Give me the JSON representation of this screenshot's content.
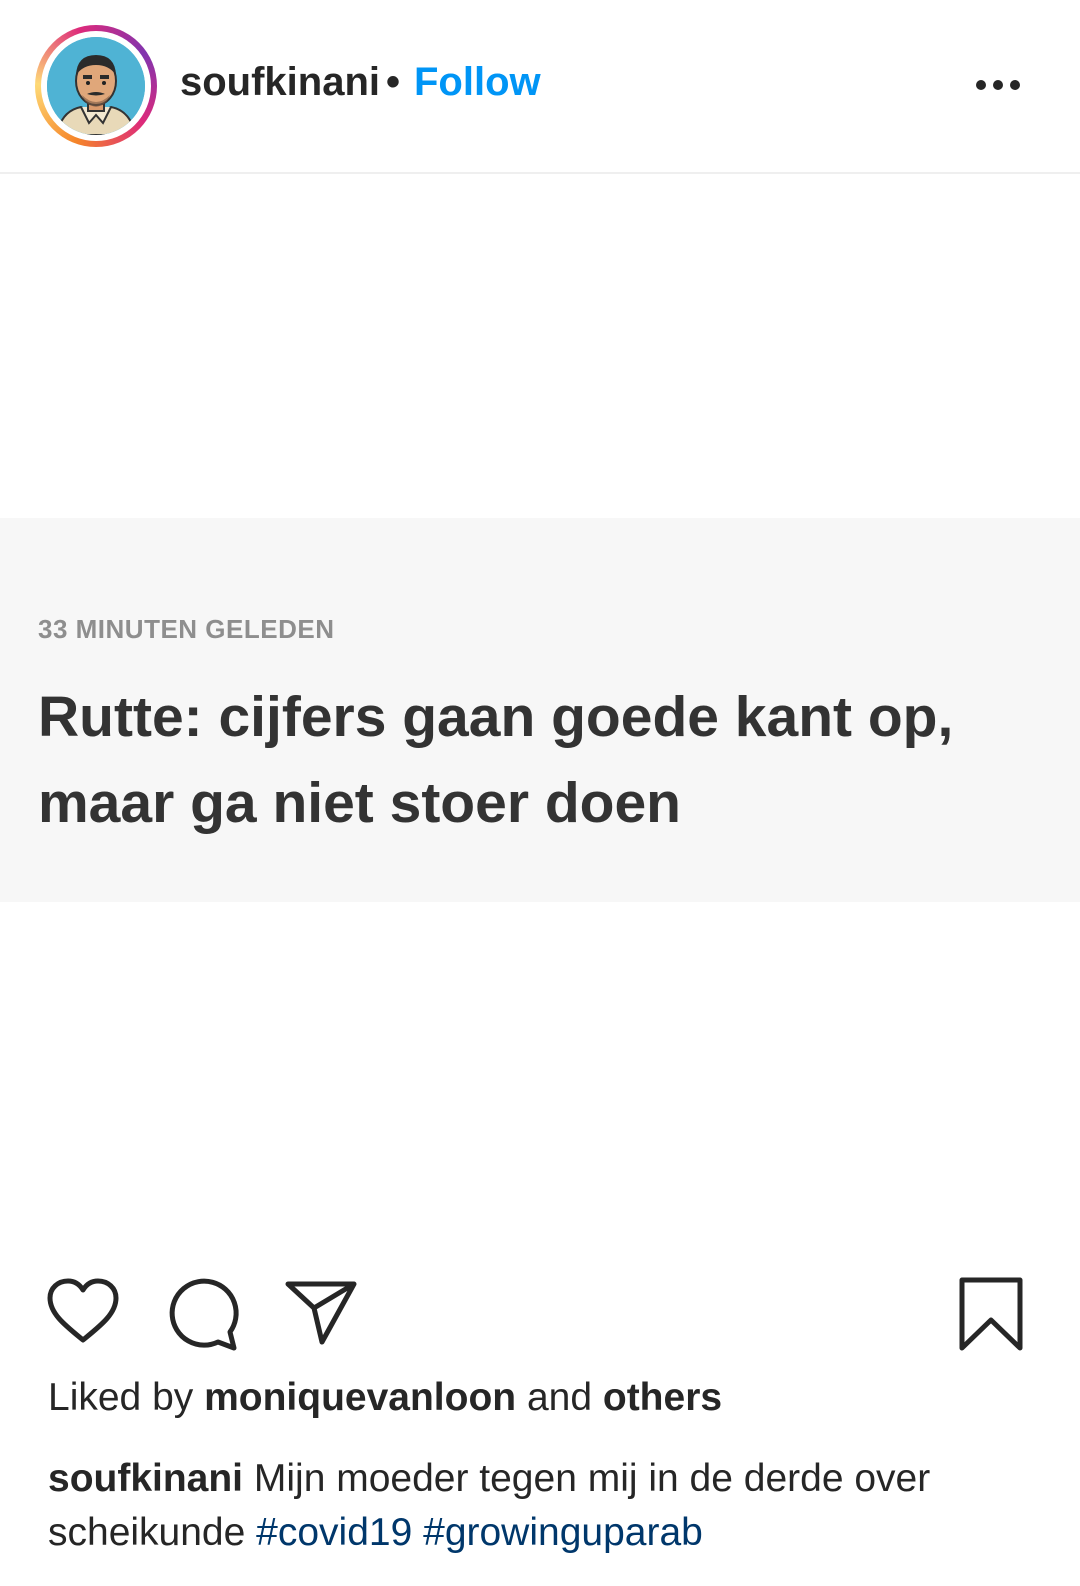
{
  "post": {
    "author": "soufkinani",
    "separator": "•",
    "follow_label": "Follow",
    "news": {
      "time": "33 MINUTEN GELEDEN",
      "headline": "Rutte: cijfers gaan goede kant op, maar ga niet stoer doen"
    },
    "likes": {
      "prefix": "Liked by",
      "user": "moniquevanloon",
      "middle": "and",
      "suffix": "others"
    },
    "caption": {
      "author": "soufkinani",
      "text": "Mijn moeder tegen mij in de derde over scheikunde",
      "hashtags": [
        "#covid19",
        "#growinguparab"
      ]
    }
  },
  "icons": {
    "more": "more-options-icon",
    "like": "heart-icon",
    "comment": "comment-icon",
    "share": "send-icon",
    "save": "bookmark-icon"
  },
  "colors": {
    "follow": "#0095f6",
    "hashtag": "#00376b",
    "news_background": "#f7f7f7"
  }
}
